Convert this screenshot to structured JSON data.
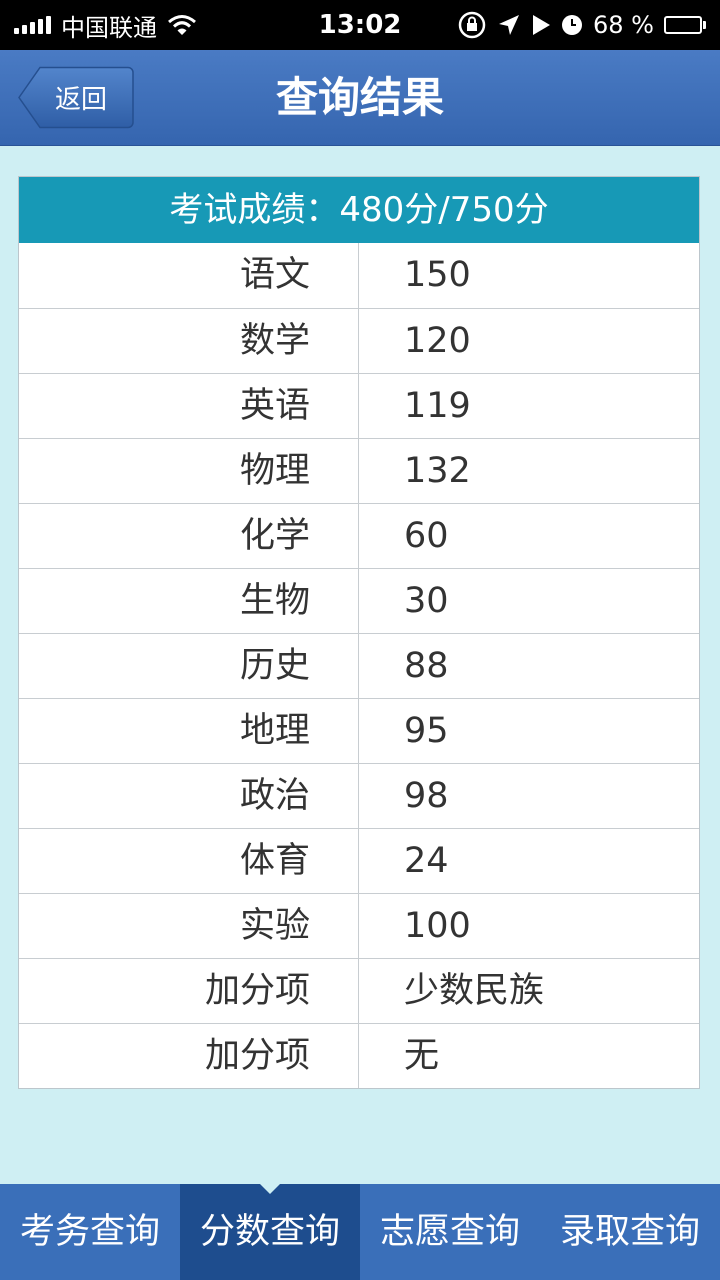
{
  "status_bar": {
    "carrier": "中国联通",
    "time": "13:02",
    "battery_percent": "68 %",
    "battery_level": 0.68
  },
  "nav": {
    "back_label": "返回",
    "title": "查询结果"
  },
  "score": {
    "header": "考试成绩：480分/750分",
    "rows": [
      {
        "subject": "语文",
        "value": "150"
      },
      {
        "subject": "数学",
        "value": "120"
      },
      {
        "subject": "英语",
        "value": "119"
      },
      {
        "subject": "物理",
        "value": "132"
      },
      {
        "subject": "化学",
        "value": "60"
      },
      {
        "subject": "生物",
        "value": "30"
      },
      {
        "subject": "历史",
        "value": "88"
      },
      {
        "subject": "地理",
        "value": "95"
      },
      {
        "subject": "政治",
        "value": "98"
      },
      {
        "subject": "体育",
        "value": "24"
      },
      {
        "subject": "实验",
        "value": "100"
      },
      {
        "subject": "加分项",
        "value": "少数民族"
      },
      {
        "subject": "加分项",
        "value": "无"
      }
    ]
  },
  "tabs": [
    {
      "label": "考务查询"
    },
    {
      "label": "分数查询"
    },
    {
      "label": "志愿查询"
    },
    {
      "label": "录取查询"
    }
  ],
  "active_tab": 1,
  "colors": {
    "nav_blue": "#3a6fb9",
    "header_teal": "#1799b6",
    "background": "#cfeff3",
    "active_tab": "#1e4d8e"
  }
}
